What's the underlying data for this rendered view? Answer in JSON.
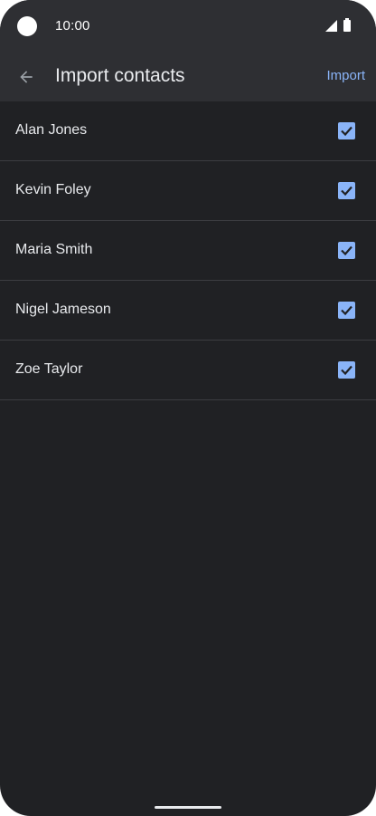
{
  "status_bar": {
    "time": "10:00",
    "icons": [
      "camera-dot",
      "cellular-signal-icon",
      "battery-icon"
    ]
  },
  "app_bar": {
    "back_icon": "arrow-back-icon",
    "title": "Import contacts",
    "action_label": "Import"
  },
  "contacts": [
    {
      "name": "Alan Jones",
      "checked": true
    },
    {
      "name": "Kevin Foley",
      "checked": true
    },
    {
      "name": "Maria Smith",
      "checked": true
    },
    {
      "name": "Nigel Jameson",
      "checked": true
    },
    {
      "name": "Zoe Taylor",
      "checked": true
    }
  ],
  "colors": {
    "background": "#202124",
    "app_bar": "#2e2f33",
    "accent": "#8ab4f8",
    "text": "#e8eaed",
    "divider": "#3c3d41"
  }
}
